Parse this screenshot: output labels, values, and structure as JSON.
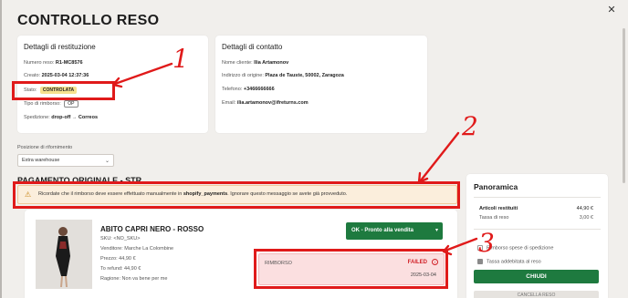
{
  "modal": {
    "title": "CONTROLLO RESO"
  },
  "return_details": {
    "heading": "Dettagli di restituzione",
    "number_label": "Numero reso:",
    "number_value": "R1-MC8576",
    "created_label": "Creato:",
    "created_value": "2025-03-04 12:37:36",
    "status_label": "Stato:",
    "status_value": "CONTROLATA",
    "refund_type_label": "Tipo di rimborso:",
    "refund_type_value": "OP",
    "shipping_label": "Spedizione:",
    "shipping_value": "drop-off",
    "shipping_carrier": "Correos"
  },
  "contact_details": {
    "heading": "Dettagli di contatto",
    "name_label": "Nome cliente:",
    "name_value": "Ilia Artamonov",
    "address_label": "Indirizzo di origine:",
    "address_value": "Plaza de Tauste, 50002, Zaragoza",
    "phone_label": "Telefono:",
    "phone_value": "+3466666666",
    "email_label": "Email:",
    "email_value": "ilia.artamonov@ifreturns.com"
  },
  "restock": {
    "label": "Posizione di rifornimento",
    "selected": "Extra warehouse"
  },
  "original_payment": {
    "heading": "PAGAMENTO ORIGINALE - STR",
    "warning_prefix": "Ricordate che il rimborso deve essere effettuato manualmente in",
    "warning_bold": "shopify_payments",
    "warning_suffix": ". Ignorare questo messaggio se avete già provveduto."
  },
  "product": {
    "name": "ABITO CAPRI NERO - ROSSO",
    "sku": "SKU: <NO_SKU>",
    "seller": "Venditore: Marche La Colombine",
    "price": "Prezzo: 44,90 €",
    "to_refund": "To refund: 44,90 €",
    "reason": "Ragione: Non va bene per me",
    "action_label": "OK - Pronto alla vendita"
  },
  "refund": {
    "label": "RIMBORSO",
    "status": "FAILED",
    "date": "2025-03-04"
  },
  "summary": {
    "heading": "Panoramica",
    "items_label": "Articoli restituiti",
    "items_value": "44,90 €",
    "fee_label": "Tassa di reso",
    "fee_value": "3,00 €",
    "opt_shipping": "Rimborso spese di spedizione",
    "opt_fee": "Tassa addebitata al reso",
    "close_label": "CHIUDI",
    "cancel_label": "CANCELLA RESO"
  },
  "annotations": {
    "n1": "1",
    "n2": "2",
    "n3": "3"
  },
  "colors": {
    "accent_green": "#1e7a3f",
    "annotation_red": "#e01a1a",
    "status_yellow": "#f6e28f",
    "warning_bg": "#fbeedc",
    "failed_bg": "#fbdfe0"
  }
}
